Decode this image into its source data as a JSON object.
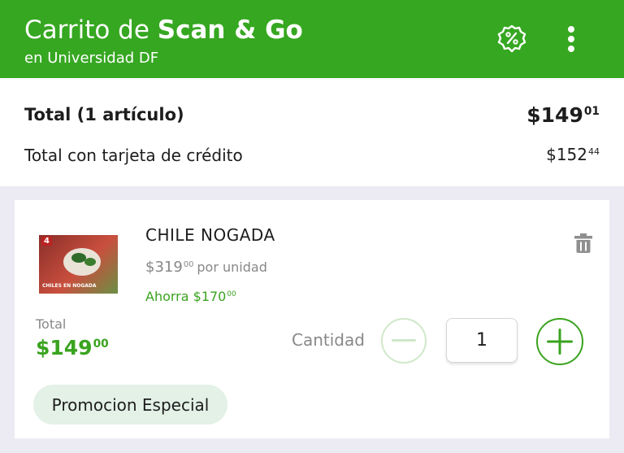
{
  "header": {
    "title_plain": "Carrito de ",
    "title_bold": "Scan & Go",
    "subtitle": "en Universidad DF",
    "brand_color": "#36a721",
    "icons": [
      "discount-badge-icon",
      "more-vertical-icon"
    ]
  },
  "totals": {
    "total_label": "Total (1 artículo)",
    "total_value": "$149",
    "total_cents": "01",
    "credit_label": "Total con tarjeta de crédito",
    "credit_value": "$152",
    "credit_cents": "44"
  },
  "item": {
    "image_badge": "4",
    "image_caption": "CHILES EN NOGADA",
    "name": "CHILE NOGADA",
    "price": "$319",
    "price_cents": "00",
    "unit": "por unidad",
    "savings": "Ahorra $170",
    "savings_cents": "00",
    "total_label": "Total",
    "total_value": "$149",
    "total_cents": "00",
    "quantity_label": "Cantidad",
    "quantity": "1",
    "promo": "Promocion Especial",
    "accent_color": "#3aa31f"
  }
}
